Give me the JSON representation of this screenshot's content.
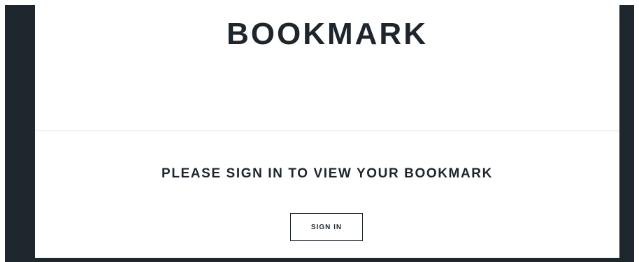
{
  "page": {
    "title": "BOOKMARK",
    "message": "PLEASE SIGN IN TO VIEW YOUR BOOKMARK",
    "signin_label": "SIGN IN"
  }
}
